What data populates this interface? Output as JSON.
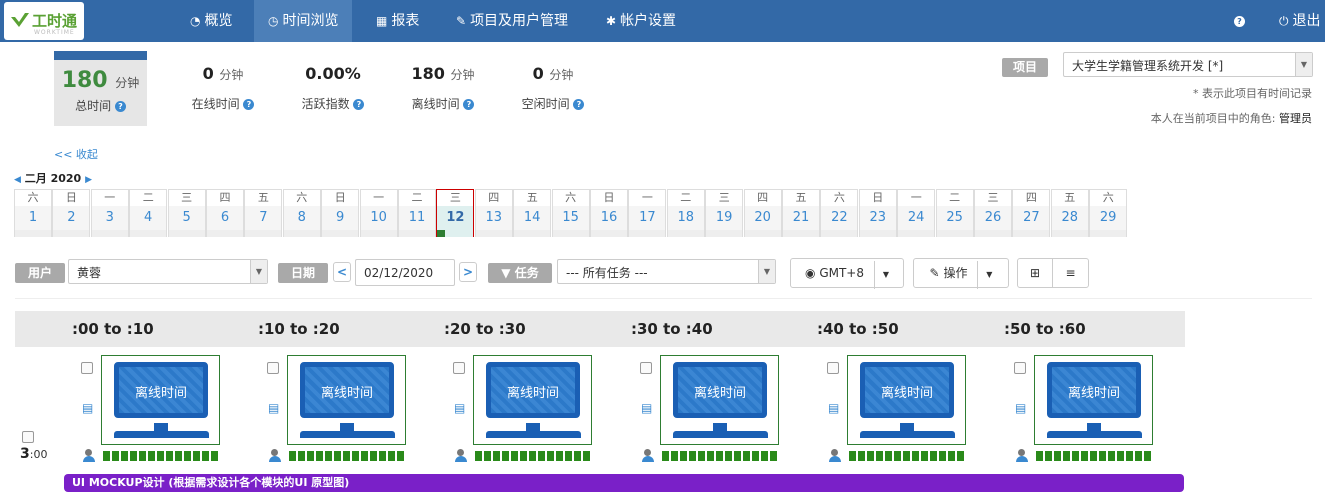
{
  "app": {
    "logo_text": "工时通",
    "logo_sub": "WORKTIME"
  },
  "nav": {
    "items": [
      {
        "label": "概览",
        "icon": "dashboard-icon"
      },
      {
        "label": "时间浏览",
        "icon": "clock-icon",
        "active": true
      },
      {
        "label": "报表",
        "icon": "chart-icon"
      },
      {
        "label": "项目及用户管理",
        "icon": "wrench-icon"
      },
      {
        "label": "帐户设置",
        "icon": "gear-icon"
      }
    ],
    "help": "?",
    "logout": "退出"
  },
  "summary": {
    "total": {
      "value": "180",
      "unit": "分钟",
      "label": "总时间"
    },
    "stats": [
      {
        "value": "0",
        "unit": "分钟",
        "label": "在线时间"
      },
      {
        "value": "0.00%",
        "unit": "",
        "label": "活跃指数"
      },
      {
        "value": "180",
        "unit": "分钟",
        "label": "离线时间"
      },
      {
        "value": "0",
        "unit": "分钟",
        "label": "空闲时间"
      }
    ]
  },
  "project": {
    "label": "项目",
    "selected": "大学生学籍管理系统开发  [*]",
    "note": "* 表示此项目有时间记录",
    "role_prefix": "本人在当前项目中的角色:",
    "role": "管理员"
  },
  "collapse": "<< 收起",
  "calendar": {
    "month": "二月 2020",
    "selected": 12,
    "days": [
      {
        "w": "六",
        "d": "1"
      },
      {
        "w": "日",
        "d": "2"
      },
      {
        "w": "一",
        "d": "3"
      },
      {
        "w": "二",
        "d": "4"
      },
      {
        "w": "三",
        "d": "5"
      },
      {
        "w": "四",
        "d": "6"
      },
      {
        "w": "五",
        "d": "7"
      },
      {
        "w": "六",
        "d": "8"
      },
      {
        "w": "日",
        "d": "9"
      },
      {
        "w": "一",
        "d": "10"
      },
      {
        "w": "二",
        "d": "11"
      },
      {
        "w": "三",
        "d": "12"
      },
      {
        "w": "四",
        "d": "13"
      },
      {
        "w": "五",
        "d": "14"
      },
      {
        "w": "六",
        "d": "15"
      },
      {
        "w": "日",
        "d": "16"
      },
      {
        "w": "一",
        "d": "17"
      },
      {
        "w": "二",
        "d": "18"
      },
      {
        "w": "三",
        "d": "19"
      },
      {
        "w": "四",
        "d": "20"
      },
      {
        "w": "五",
        "d": "21"
      },
      {
        "w": "六",
        "d": "22"
      },
      {
        "w": "日",
        "d": "23"
      },
      {
        "w": "一",
        "d": "24"
      },
      {
        "w": "二",
        "d": "25"
      },
      {
        "w": "三",
        "d": "26"
      },
      {
        "w": "四",
        "d": "27"
      },
      {
        "w": "五",
        "d": "28"
      },
      {
        "w": "六",
        "d": "29"
      }
    ]
  },
  "filters": {
    "user_label": "用户",
    "user_value": "黄蓉",
    "date_label": "日期",
    "date_value": "02/12/2020",
    "task_label": "任务",
    "task_value": "--- 所有任务 ---",
    "timezone": "GMT+8",
    "ops": "操作"
  },
  "grid": {
    "columns": [
      ":00 to :10",
      ":10 to :20",
      ":20 to :30",
      ":30 to :40",
      ":40 to :50",
      ":50 to :60"
    ],
    "hour": "3",
    "hour_suffix": ":00",
    "screen_text": "离线时间",
    "task_bar": "UI MOCKUP设计 (根据需求设计各个模块的UI 原型图)"
  }
}
